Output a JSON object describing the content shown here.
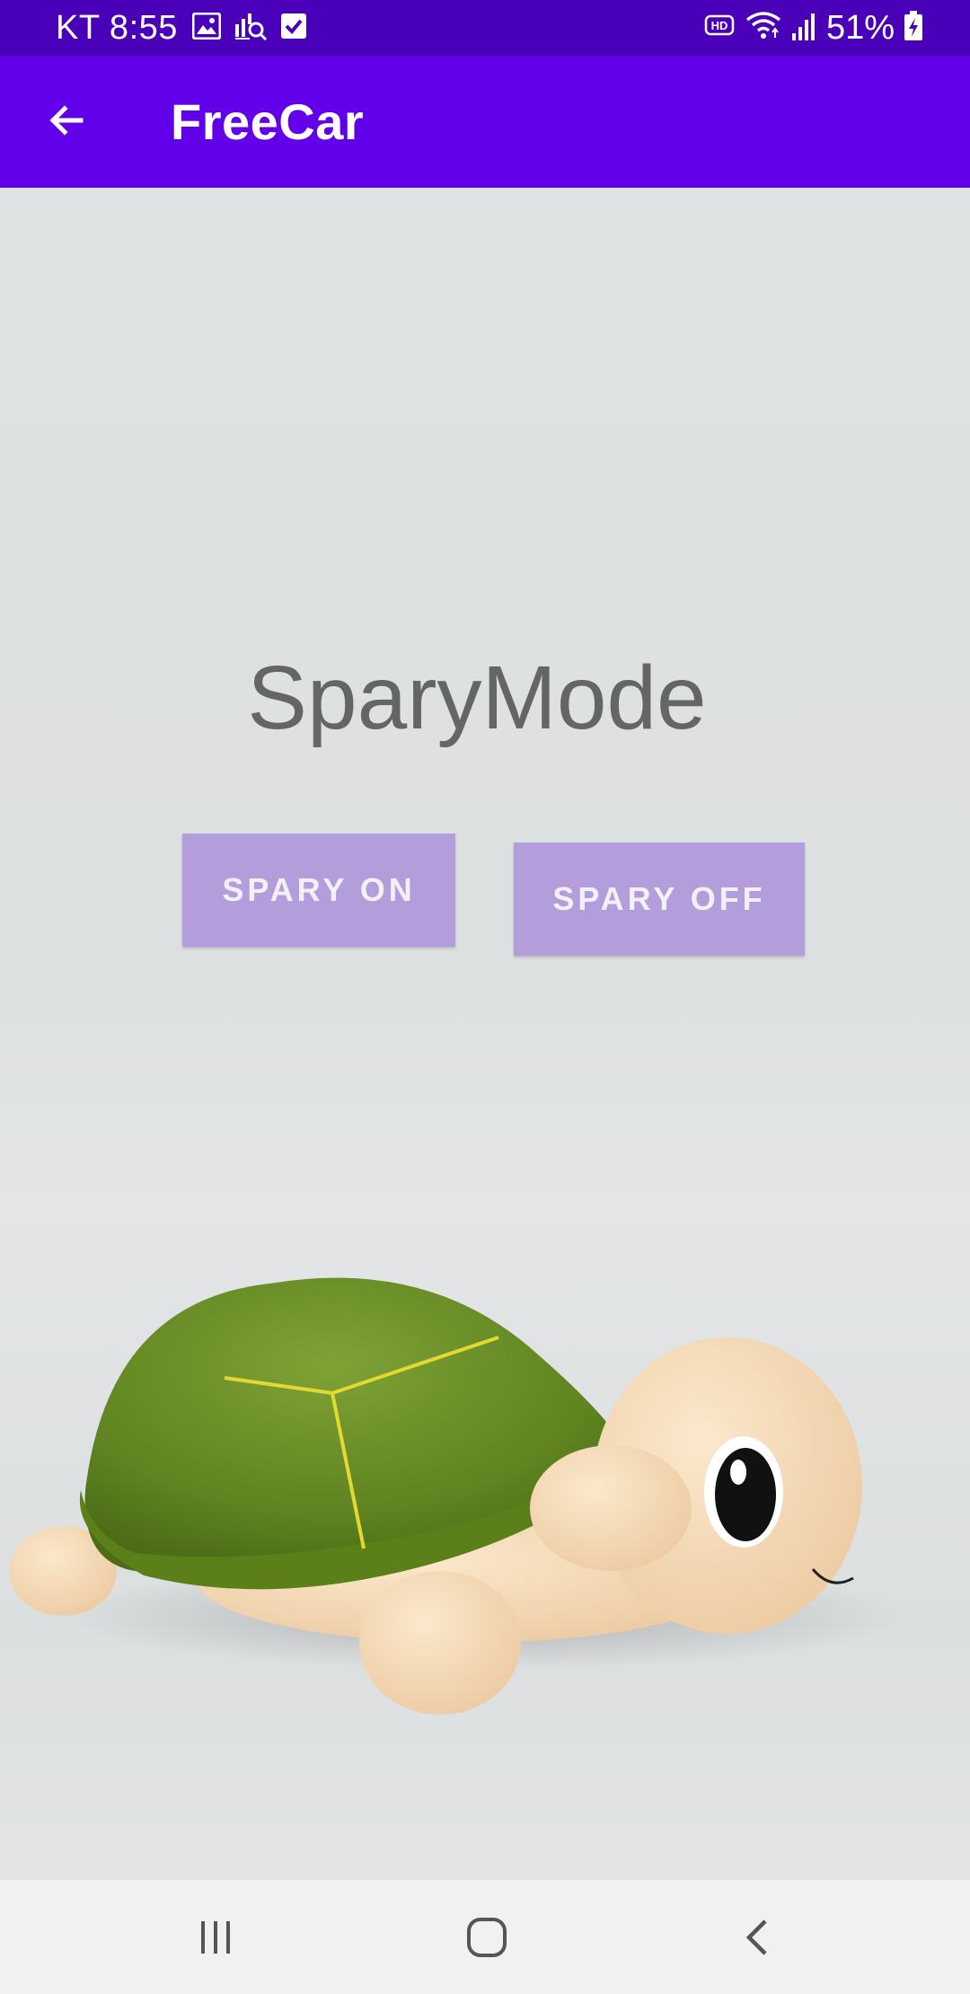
{
  "status_bar": {
    "carrier_time": "KT 8:55",
    "battery_percent": "51%",
    "icons": [
      "image-icon",
      "chart-search-icon",
      "checkbox-icon",
      "hd-icon",
      "wifi-icon",
      "signal-icon",
      "battery-charging-icon"
    ]
  },
  "app_bar": {
    "title": "FreeCar",
    "back_icon": "arrow-back-icon",
    "background_color": "#6200ea"
  },
  "main": {
    "title": "SparyMode",
    "buttons": {
      "on_label": "SPARY ON",
      "off_label": "SPARY OFF",
      "color": "#b39ddb"
    },
    "image": "plush-turtle-toy"
  },
  "nav_bar": {
    "icons": [
      "recents-icon",
      "home-icon",
      "back-icon"
    ]
  }
}
